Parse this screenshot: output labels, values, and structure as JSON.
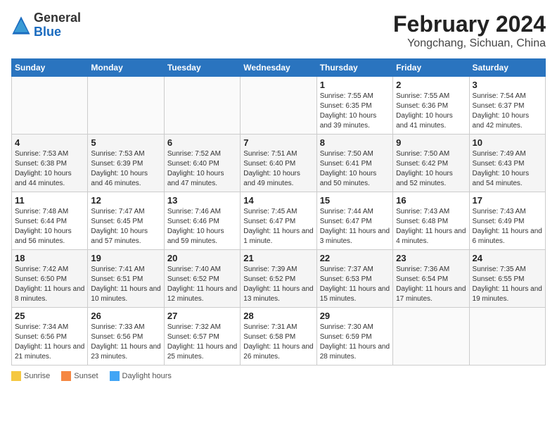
{
  "header": {
    "logo_general": "General",
    "logo_blue": "Blue",
    "month_year": "February 2024",
    "location": "Yongchang, Sichuan, China"
  },
  "days_of_week": [
    "Sunday",
    "Monday",
    "Tuesday",
    "Wednesday",
    "Thursday",
    "Friday",
    "Saturday"
  ],
  "weeks": [
    [
      {
        "day": "",
        "detail": ""
      },
      {
        "day": "",
        "detail": ""
      },
      {
        "day": "",
        "detail": ""
      },
      {
        "day": "",
        "detail": ""
      },
      {
        "day": "1",
        "detail": "Sunrise: 7:55 AM\nSunset: 6:35 PM\nDaylight: 10 hours and 39 minutes."
      },
      {
        "day": "2",
        "detail": "Sunrise: 7:55 AM\nSunset: 6:36 PM\nDaylight: 10 hours and 41 minutes."
      },
      {
        "day": "3",
        "detail": "Sunrise: 7:54 AM\nSunset: 6:37 PM\nDaylight: 10 hours and 42 minutes."
      }
    ],
    [
      {
        "day": "4",
        "detail": "Sunrise: 7:53 AM\nSunset: 6:38 PM\nDaylight: 10 hours and 44 minutes."
      },
      {
        "day": "5",
        "detail": "Sunrise: 7:53 AM\nSunset: 6:39 PM\nDaylight: 10 hours and 46 minutes."
      },
      {
        "day": "6",
        "detail": "Sunrise: 7:52 AM\nSunset: 6:40 PM\nDaylight: 10 hours and 47 minutes."
      },
      {
        "day": "7",
        "detail": "Sunrise: 7:51 AM\nSunset: 6:40 PM\nDaylight: 10 hours and 49 minutes."
      },
      {
        "day": "8",
        "detail": "Sunrise: 7:50 AM\nSunset: 6:41 PM\nDaylight: 10 hours and 50 minutes."
      },
      {
        "day": "9",
        "detail": "Sunrise: 7:50 AM\nSunset: 6:42 PM\nDaylight: 10 hours and 52 minutes."
      },
      {
        "day": "10",
        "detail": "Sunrise: 7:49 AM\nSunset: 6:43 PM\nDaylight: 10 hours and 54 minutes."
      }
    ],
    [
      {
        "day": "11",
        "detail": "Sunrise: 7:48 AM\nSunset: 6:44 PM\nDaylight: 10 hours and 56 minutes."
      },
      {
        "day": "12",
        "detail": "Sunrise: 7:47 AM\nSunset: 6:45 PM\nDaylight: 10 hours and 57 minutes."
      },
      {
        "day": "13",
        "detail": "Sunrise: 7:46 AM\nSunset: 6:46 PM\nDaylight: 10 hours and 59 minutes."
      },
      {
        "day": "14",
        "detail": "Sunrise: 7:45 AM\nSunset: 6:47 PM\nDaylight: 11 hours and 1 minute."
      },
      {
        "day": "15",
        "detail": "Sunrise: 7:44 AM\nSunset: 6:47 PM\nDaylight: 11 hours and 3 minutes."
      },
      {
        "day": "16",
        "detail": "Sunrise: 7:43 AM\nSunset: 6:48 PM\nDaylight: 11 hours and 4 minutes."
      },
      {
        "day": "17",
        "detail": "Sunrise: 7:43 AM\nSunset: 6:49 PM\nDaylight: 11 hours and 6 minutes."
      }
    ],
    [
      {
        "day": "18",
        "detail": "Sunrise: 7:42 AM\nSunset: 6:50 PM\nDaylight: 11 hours and 8 minutes."
      },
      {
        "day": "19",
        "detail": "Sunrise: 7:41 AM\nSunset: 6:51 PM\nDaylight: 11 hours and 10 minutes."
      },
      {
        "day": "20",
        "detail": "Sunrise: 7:40 AM\nSunset: 6:52 PM\nDaylight: 11 hours and 12 minutes."
      },
      {
        "day": "21",
        "detail": "Sunrise: 7:39 AM\nSunset: 6:52 PM\nDaylight: 11 hours and 13 minutes."
      },
      {
        "day": "22",
        "detail": "Sunrise: 7:37 AM\nSunset: 6:53 PM\nDaylight: 11 hours and 15 minutes."
      },
      {
        "day": "23",
        "detail": "Sunrise: 7:36 AM\nSunset: 6:54 PM\nDaylight: 11 hours and 17 minutes."
      },
      {
        "day": "24",
        "detail": "Sunrise: 7:35 AM\nSunset: 6:55 PM\nDaylight: 11 hours and 19 minutes."
      }
    ],
    [
      {
        "day": "25",
        "detail": "Sunrise: 7:34 AM\nSunset: 6:56 PM\nDaylight: 11 hours and 21 minutes."
      },
      {
        "day": "26",
        "detail": "Sunrise: 7:33 AM\nSunset: 6:56 PM\nDaylight: 11 hours and 23 minutes."
      },
      {
        "day": "27",
        "detail": "Sunrise: 7:32 AM\nSunset: 6:57 PM\nDaylight: 11 hours and 25 minutes."
      },
      {
        "day": "28",
        "detail": "Sunrise: 7:31 AM\nSunset: 6:58 PM\nDaylight: 11 hours and 26 minutes."
      },
      {
        "day": "29",
        "detail": "Sunrise: 7:30 AM\nSunset: 6:59 PM\nDaylight: 11 hours and 28 minutes."
      },
      {
        "day": "",
        "detail": ""
      },
      {
        "day": "",
        "detail": ""
      }
    ]
  ],
  "footer": {
    "sunrise_label": "Sunrise",
    "sunset_label": "Sunset",
    "daylight_label": "Daylight hours"
  }
}
